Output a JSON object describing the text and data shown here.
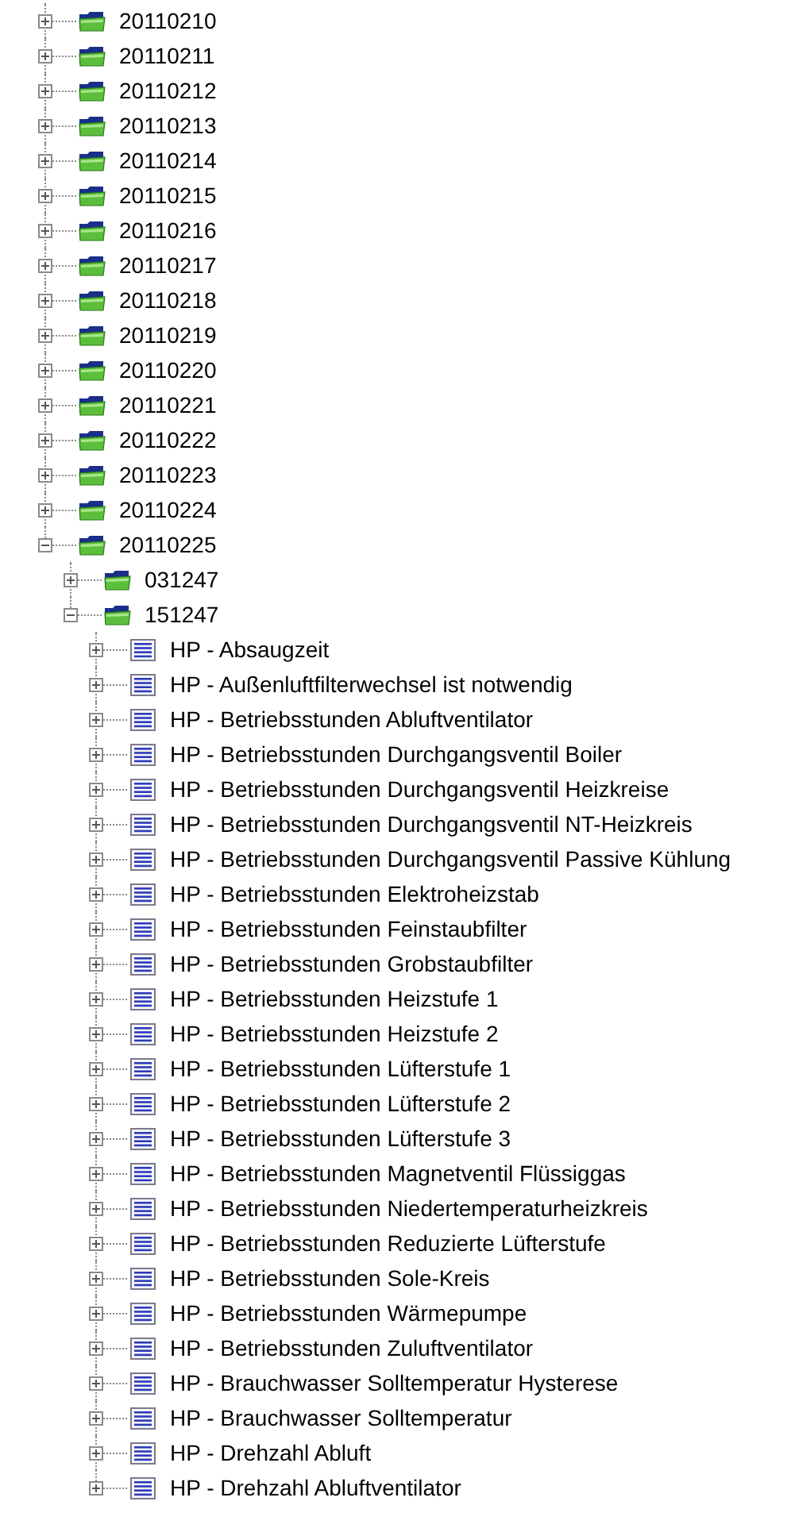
{
  "tree": [
    {
      "label": "20110210",
      "kind": "folder",
      "expanded": false
    },
    {
      "label": "20110211",
      "kind": "folder",
      "expanded": false
    },
    {
      "label": "20110212",
      "kind": "folder",
      "expanded": false
    },
    {
      "label": "20110213",
      "kind": "folder",
      "expanded": false
    },
    {
      "label": "20110214",
      "kind": "folder",
      "expanded": false
    },
    {
      "label": "20110215",
      "kind": "folder",
      "expanded": false
    },
    {
      "label": "20110216",
      "kind": "folder",
      "expanded": false
    },
    {
      "label": "20110217",
      "kind": "folder",
      "expanded": false
    },
    {
      "label": "20110218",
      "kind": "folder",
      "expanded": false
    },
    {
      "label": "20110219",
      "kind": "folder",
      "expanded": false
    },
    {
      "label": "20110220",
      "kind": "folder",
      "expanded": false
    },
    {
      "label": "20110221",
      "kind": "folder",
      "expanded": false
    },
    {
      "label": "20110222",
      "kind": "folder",
      "expanded": false
    },
    {
      "label": "20110223",
      "kind": "folder",
      "expanded": false
    },
    {
      "label": "20110224",
      "kind": "folder",
      "expanded": false
    },
    {
      "label": "20110225",
      "kind": "folder",
      "expanded": true,
      "children": [
        {
          "label": "031247",
          "kind": "folder",
          "expanded": false
        },
        {
          "label": "151247",
          "kind": "folder",
          "expanded": true,
          "children": [
            {
              "label": "HP - Absaugzeit",
              "kind": "document",
              "expanded": false
            },
            {
              "label": "HP - Außenluftfilterwechsel ist notwendig",
              "kind": "document",
              "expanded": false
            },
            {
              "label": "HP - Betriebsstunden Abluftventilator",
              "kind": "document",
              "expanded": false
            },
            {
              "label": "HP - Betriebsstunden Durchgangsventil Boiler",
              "kind": "document",
              "expanded": false
            },
            {
              "label": "HP - Betriebsstunden Durchgangsventil Heizkreise",
              "kind": "document",
              "expanded": false
            },
            {
              "label": "HP - Betriebsstunden Durchgangsventil NT-Heizkreis",
              "kind": "document",
              "expanded": false
            },
            {
              "label": "HP - Betriebsstunden Durchgangsventil Passive Kühlung",
              "kind": "document",
              "expanded": false
            },
            {
              "label": "HP - Betriebsstunden Elektroheizstab",
              "kind": "document",
              "expanded": false
            },
            {
              "label": "HP - Betriebsstunden Feinstaubfilter",
              "kind": "document",
              "expanded": false
            },
            {
              "label": "HP - Betriebsstunden Grobstaubfilter",
              "kind": "document",
              "expanded": false
            },
            {
              "label": "HP - Betriebsstunden Heizstufe 1",
              "kind": "document",
              "expanded": false
            },
            {
              "label": "HP - Betriebsstunden Heizstufe 2",
              "kind": "document",
              "expanded": false
            },
            {
              "label": "HP - Betriebsstunden Lüfterstufe 1",
              "kind": "document",
              "expanded": false
            },
            {
              "label": "HP - Betriebsstunden Lüfterstufe 2",
              "kind": "document",
              "expanded": false
            },
            {
              "label": "HP - Betriebsstunden Lüfterstufe 3",
              "kind": "document",
              "expanded": false
            },
            {
              "label": "HP - Betriebsstunden Magnetventil Flüssiggas",
              "kind": "document",
              "expanded": false
            },
            {
              "label": "HP - Betriebsstunden Niedertemperaturheizkreis",
              "kind": "document",
              "expanded": false
            },
            {
              "label": "HP - Betriebsstunden Reduzierte Lüfterstufe",
              "kind": "document",
              "expanded": false
            },
            {
              "label": "HP - Betriebsstunden Sole-Kreis",
              "kind": "document",
              "expanded": false
            },
            {
              "label": "HP - Betriebsstunden Wärmepumpe",
              "kind": "document",
              "expanded": false
            },
            {
              "label": "HP - Betriebsstunden Zuluftventilator",
              "kind": "document",
              "expanded": false
            },
            {
              "label": "HP - Brauchwasser Solltemperatur Hysterese",
              "kind": "document",
              "expanded": false
            },
            {
              "label": "HP - Brauchwasser Solltemperatur",
              "kind": "document",
              "expanded": false
            },
            {
              "label": "HP - Drehzahl Abluft",
              "kind": "document",
              "expanded": false
            },
            {
              "label": "HP - Drehzahl Abluftventilator",
              "kind": "document",
              "expanded": false
            }
          ]
        }
      ]
    }
  ]
}
